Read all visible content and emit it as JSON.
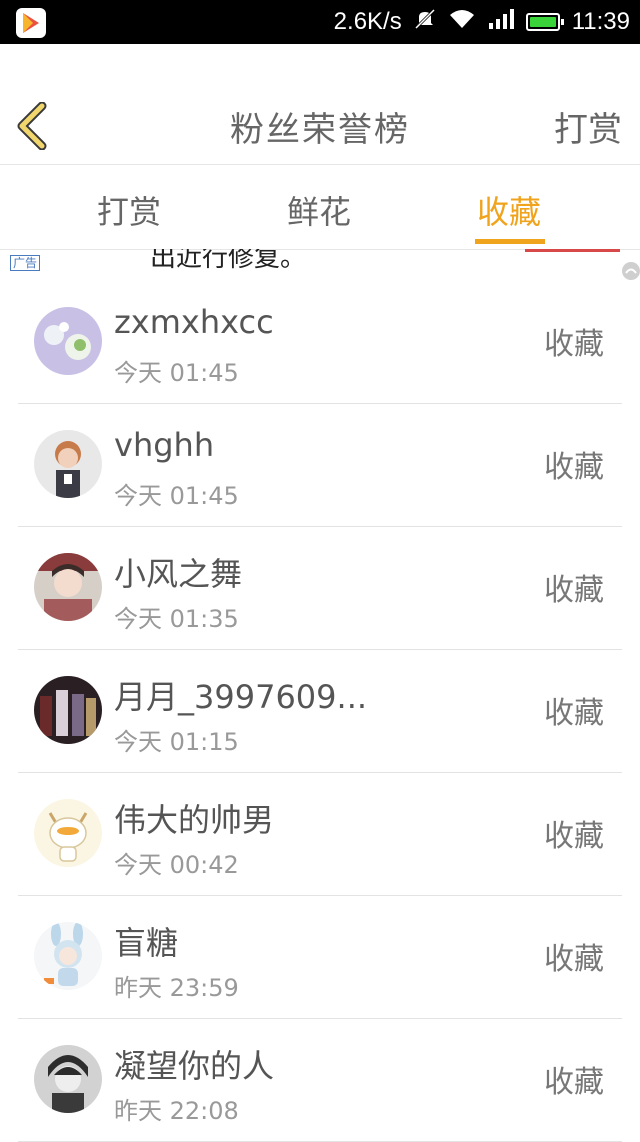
{
  "status_bar": {
    "speed": "2.6K/s",
    "time": "11:39",
    "icons": [
      "play-store-icon",
      "mute-icon",
      "wifi-icon",
      "signal-icon",
      "battery-icon"
    ]
  },
  "header": {
    "title": "粉丝荣誉榜",
    "action_label": "打赏"
  },
  "tabs": [
    {
      "label": "打赏"
    },
    {
      "label": "鲜花"
    },
    {
      "label": "收藏",
      "active": true
    }
  ],
  "ad": {
    "badge": "广告",
    "text": "出近行修复。"
  },
  "list": [
    {
      "name": "zxmxhxcc",
      "time": "今天 01:45",
      "action": "收藏"
    },
    {
      "name": "vhghh",
      "time": "今天 01:45",
      "action": "收藏"
    },
    {
      "name": "小风之舞",
      "time": "今天 01:35",
      "action": "收藏"
    },
    {
      "name": "月月_3997609...",
      "time": "今天 01:15",
      "action": "收藏"
    },
    {
      "name": "伟大的帅男",
      "time": "今天 00:42",
      "action": "收藏"
    },
    {
      "name": "盲糖",
      "time": "昨天 23:59",
      "action": "收藏"
    },
    {
      "name": "凝望你的人",
      "time": "昨天 22:08",
      "action": "收藏"
    }
  ],
  "colors": {
    "accent": "#f0a31c",
    "text": "#555555",
    "subtext": "#999999"
  }
}
